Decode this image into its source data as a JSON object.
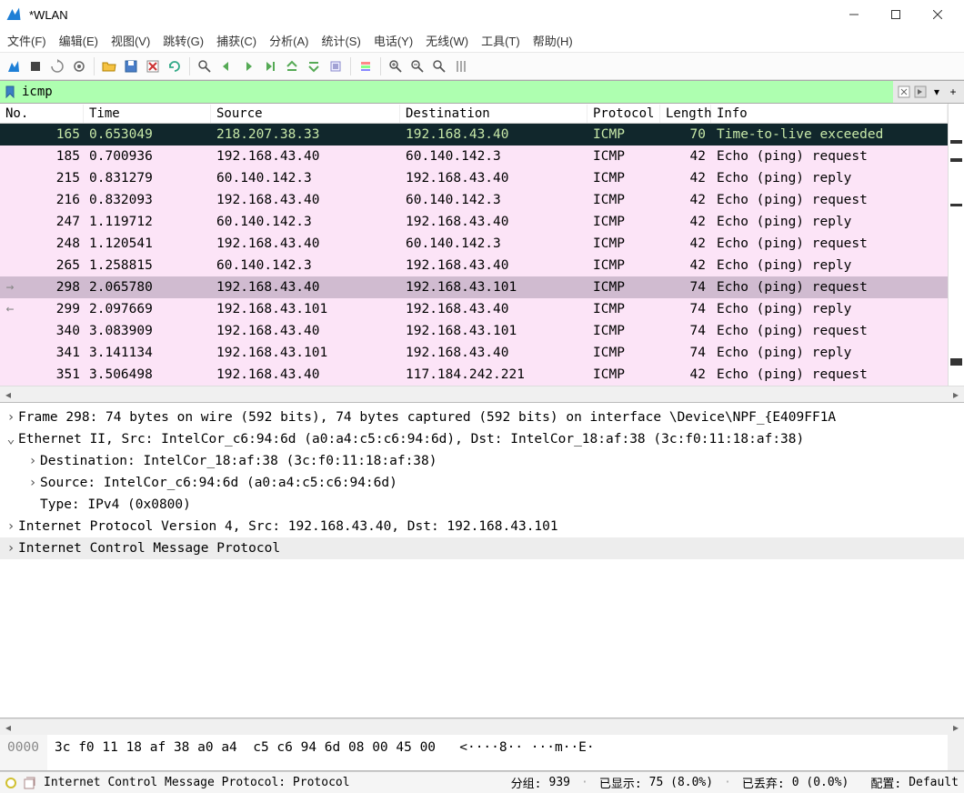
{
  "window": {
    "title": "*WLAN"
  },
  "menu": [
    "文件(F)",
    "编辑(E)",
    "视图(V)",
    "跳转(G)",
    "捕获(C)",
    "分析(A)",
    "统计(S)",
    "电话(Y)",
    "无线(W)",
    "工具(T)",
    "帮助(H)"
  ],
  "filter": {
    "value": "icmp"
  },
  "columns": {
    "no": "No.",
    "time": "Time",
    "source": "Source",
    "destination": "Destination",
    "protocol": "Protocol",
    "length": "Length",
    "info": "Info"
  },
  "packets": [
    {
      "no": "165",
      "time": "0.653049",
      "src": "218.207.38.33",
      "dst": "192.168.43.40",
      "proto": "ICMP",
      "len": "70",
      "info": "Time-to-live exceeded",
      "style": "dark",
      "arrow": ""
    },
    {
      "no": "185",
      "time": "0.700936",
      "src": "192.168.43.40",
      "dst": "60.140.142.3",
      "proto": "ICMP",
      "len": "42",
      "info": "Echo (ping) request",
      "style": "pink",
      "arrow": ""
    },
    {
      "no": "215",
      "time": "0.831279",
      "src": "60.140.142.3",
      "dst": "192.168.43.40",
      "proto": "ICMP",
      "len": "42",
      "info": "Echo (ping) reply",
      "style": "pink",
      "arrow": ""
    },
    {
      "no": "216",
      "time": "0.832093",
      "src": "192.168.43.40",
      "dst": "60.140.142.3",
      "proto": "ICMP",
      "len": "42",
      "info": "Echo (ping) request",
      "style": "pink",
      "arrow": ""
    },
    {
      "no": "247",
      "time": "1.119712",
      "src": "60.140.142.3",
      "dst": "192.168.43.40",
      "proto": "ICMP",
      "len": "42",
      "info": "Echo (ping) reply",
      "style": "pink",
      "arrow": ""
    },
    {
      "no": "248",
      "time": "1.120541",
      "src": "192.168.43.40",
      "dst": "60.140.142.3",
      "proto": "ICMP",
      "len": "42",
      "info": "Echo (ping) request",
      "style": "pink",
      "arrow": ""
    },
    {
      "no": "265",
      "time": "1.258815",
      "src": "60.140.142.3",
      "dst": "192.168.43.40",
      "proto": "ICMP",
      "len": "42",
      "info": "Echo (ping) reply",
      "style": "pink",
      "arrow": ""
    },
    {
      "no": "298",
      "time": "2.065780",
      "src": "192.168.43.40",
      "dst": "192.168.43.101",
      "proto": "ICMP",
      "len": "74",
      "info": "Echo (ping) request",
      "style": "sel",
      "arrow": "→"
    },
    {
      "no": "299",
      "time": "2.097669",
      "src": "192.168.43.101",
      "dst": "192.168.43.40",
      "proto": "ICMP",
      "len": "74",
      "info": "Echo (ping) reply",
      "style": "pink",
      "arrow": "←"
    },
    {
      "no": "340",
      "time": "3.083909",
      "src": "192.168.43.40",
      "dst": "192.168.43.101",
      "proto": "ICMP",
      "len": "74",
      "info": "Echo (ping) request",
      "style": "pink",
      "arrow": ""
    },
    {
      "no": "341",
      "time": "3.141134",
      "src": "192.168.43.101",
      "dst": "192.168.43.40",
      "proto": "ICMP",
      "len": "74",
      "info": "Echo (ping) reply",
      "style": "pink",
      "arrow": ""
    },
    {
      "no": "351",
      "time": "3.506498",
      "src": "192.168.43.40",
      "dst": "117.184.242.221",
      "proto": "ICMP",
      "len": "42",
      "info": "Echo (ping) request",
      "style": "pink",
      "arrow": ""
    }
  ],
  "details": [
    {
      "level": 0,
      "caret": ">",
      "text": "Frame 298: 74 bytes on wire (592 bits), 74 bytes captured (592 bits) on interface \\Device\\NPF_{E409FF1A",
      "sel": false
    },
    {
      "level": 0,
      "caret": "v",
      "text": "Ethernet II, Src: IntelCor_c6:94:6d (a0:a4:c5:c6:94:6d), Dst: IntelCor_18:af:38 (3c:f0:11:18:af:38)",
      "sel": false
    },
    {
      "level": 1,
      "caret": ">",
      "text": "Destination: IntelCor_18:af:38 (3c:f0:11:18:af:38)",
      "sel": false
    },
    {
      "level": 1,
      "caret": ">",
      "text": "Source: IntelCor_c6:94:6d (a0:a4:c5:c6:94:6d)",
      "sel": false
    },
    {
      "level": 1,
      "caret": "",
      "text": "Type: IPv4 (0x0800)",
      "sel": false
    },
    {
      "level": 0,
      "caret": ">",
      "text": "Internet Protocol Version 4, Src: 192.168.43.40, Dst: 192.168.43.101",
      "sel": false
    },
    {
      "level": 0,
      "caret": ">",
      "text": "Internet Control Message Protocol",
      "sel": true
    }
  ],
  "hex": {
    "offset": "0000",
    "bytes": "3c f0 11 18 af 38 a0 a4  c5 c6 94 6d 08 00 45 00",
    "ascii": "<····8·· ···m··E·"
  },
  "status": {
    "field": "Internet Control Message Protocol: Protocol",
    "packets_label": "分组:",
    "packets_value": "939",
    "displayed_label": "已显示:",
    "displayed_value": "75 (8.0%)",
    "dropped_label": "已丢弃:",
    "dropped_value": "0 (0.0%)",
    "profile_label": "配置:",
    "profile_value": "Default"
  }
}
